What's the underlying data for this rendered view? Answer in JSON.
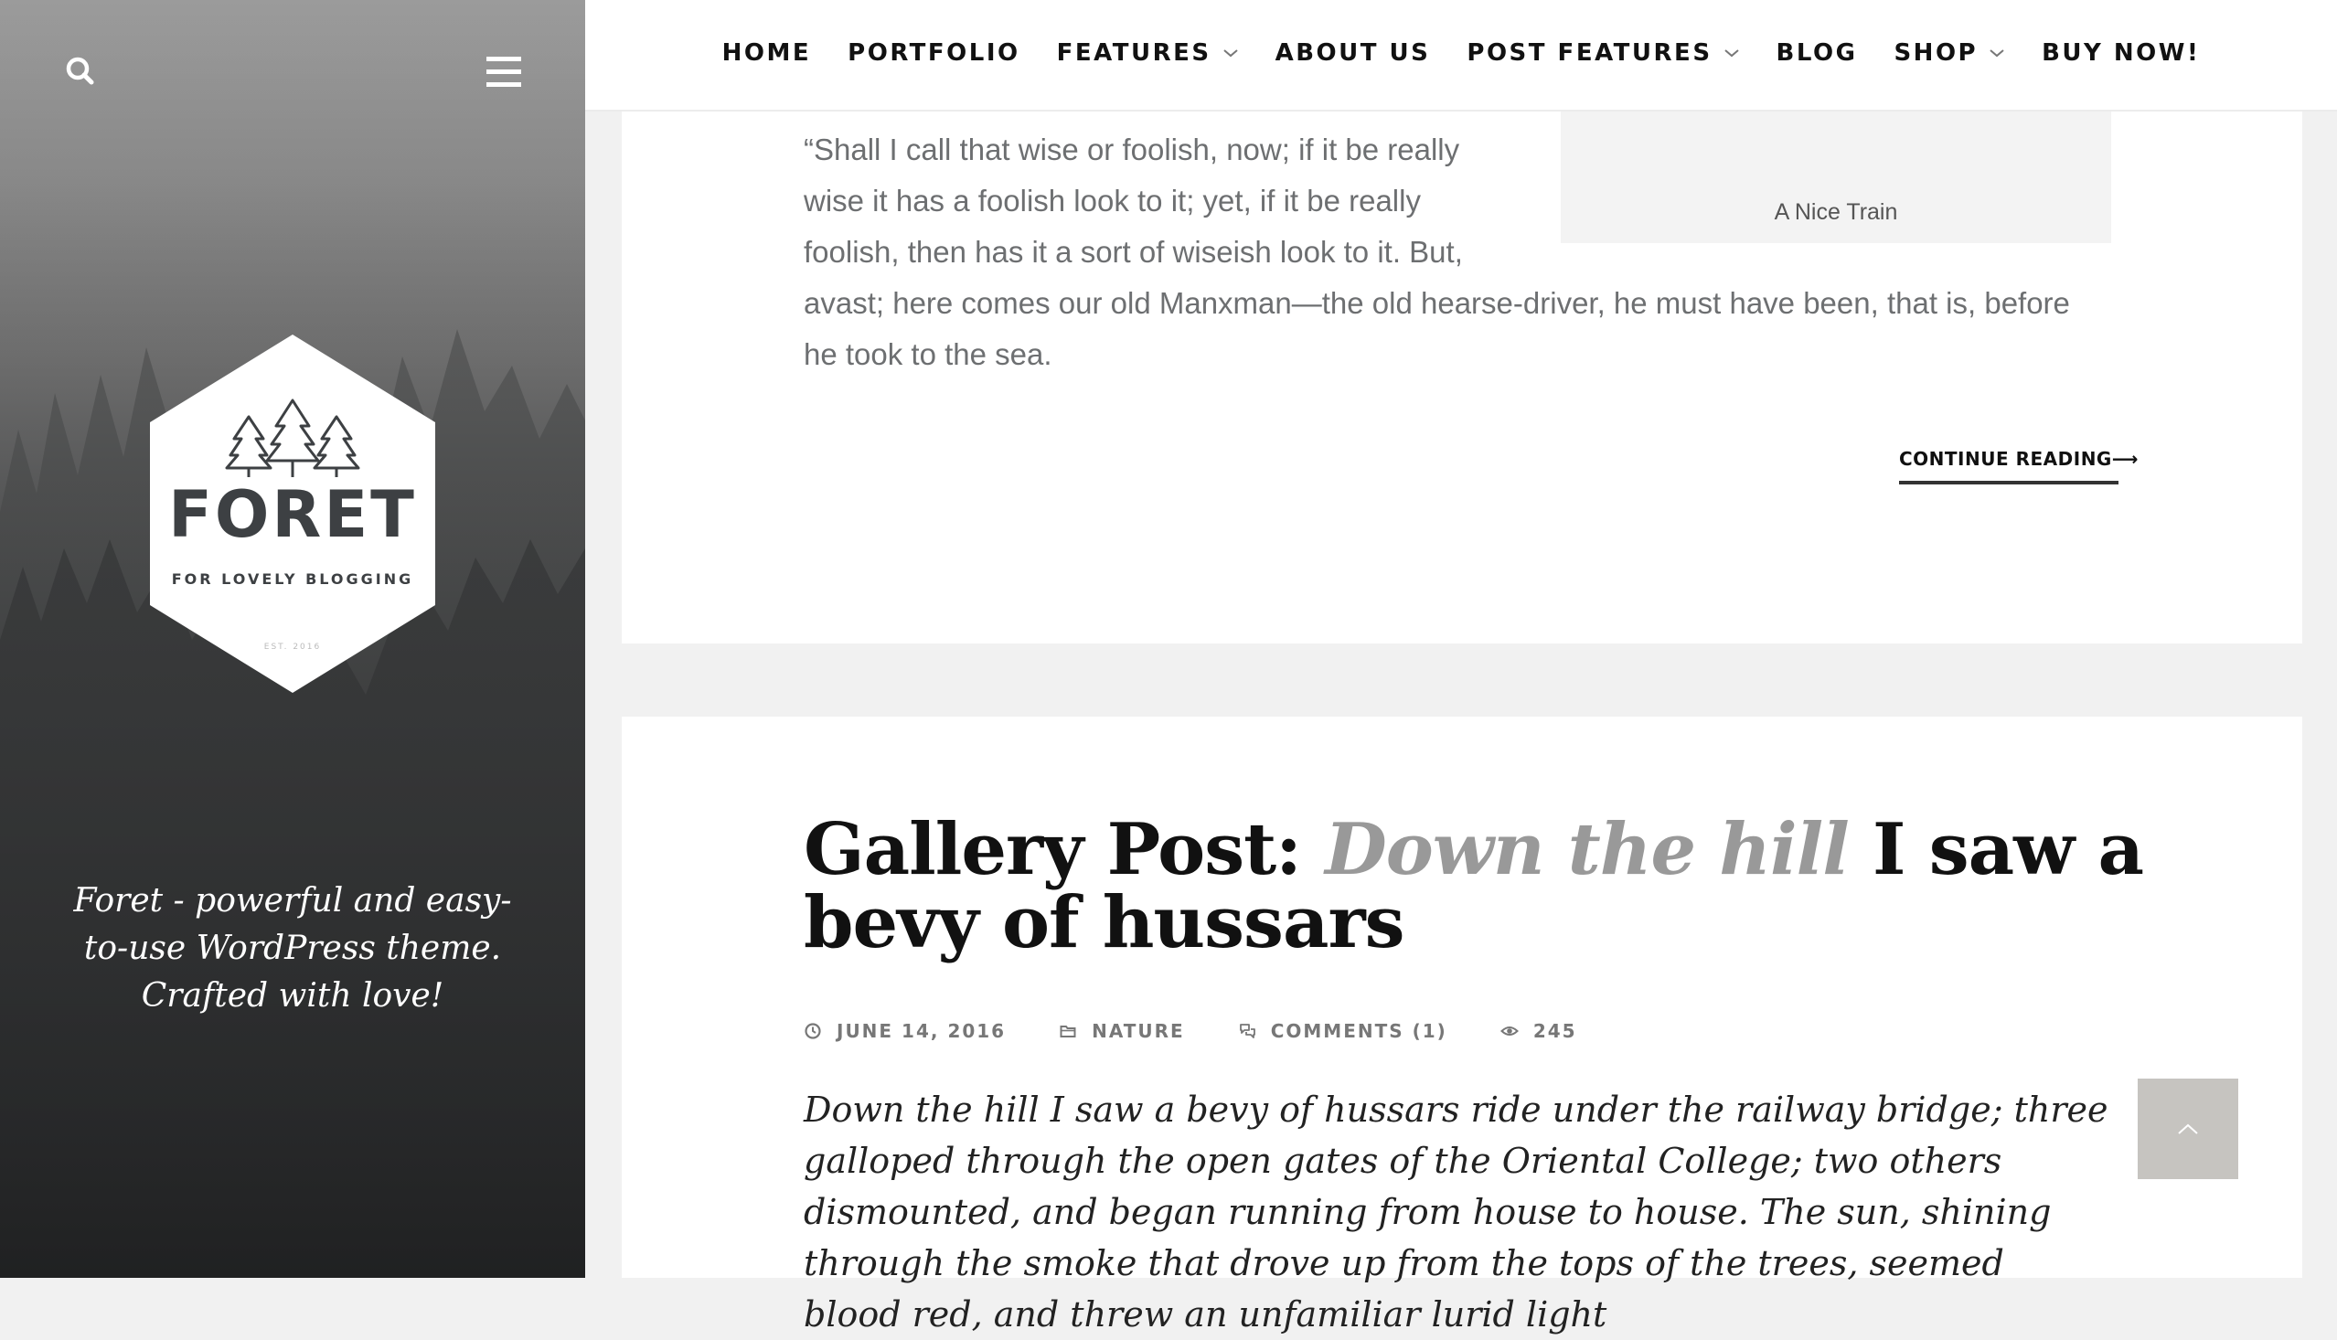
{
  "sidebar": {
    "search_icon": "search-icon",
    "menu_icon": "hamburger-icon",
    "logo": {
      "title": "FORET",
      "subtitle": "FOR LOVELY BLOGGING",
      "est": "EST. 2016"
    },
    "tagline": "Foret - powerful and easy-to-use WordPress theme. Crafted with love!"
  },
  "nav": {
    "items": [
      {
        "label": "HOME",
        "has_dropdown": false
      },
      {
        "label": "PORTFOLIO",
        "has_dropdown": false
      },
      {
        "label": "FEATURES",
        "has_dropdown": true
      },
      {
        "label": "ABOUT US",
        "has_dropdown": false
      },
      {
        "label": "POST FEATURES",
        "has_dropdown": true
      },
      {
        "label": "BLOG",
        "has_dropdown": false
      },
      {
        "label": "SHOP",
        "has_dropdown": true
      },
      {
        "label": "BUY NOW!",
        "has_dropdown": false
      }
    ]
  },
  "post1": {
    "excerpt": "“Shall I call that wise or foolish, now; if it be really wise it has a foolish look to it; yet, if it be really foolish, then has it a sort of wiseish look to it. But, avast; here comes our old Manxman—the old hearse-driver, he must have been, that is, before he took to the sea.",
    "image_caption": "A Nice Train",
    "continue_label": "CONTINUE READING",
    "continue_arrow": "⟶"
  },
  "post2": {
    "title_prefix": "Gallery Post: ",
    "title_accent": "Down the hill",
    "title_suffix": " I saw a bevy of hussars",
    "meta": {
      "date": "JUNE 14, 2016",
      "category": "NATURE",
      "comments": "COMMENTS (1)",
      "views": "245"
    },
    "body": "Down the hill I saw a bevy of hussars ride under the railway bridge; three galloped through the open gates of the Oriental College; two others dismounted, and began running from house to house. The sun, shining through the smoke that drove up from the tops of the trees, seemed blood red, and threw an unfamiliar lurid light"
  },
  "back_to_top_icon": "chevron-up-icon",
  "colors": {
    "accent_gray": "#999999",
    "text_dark": "#111111",
    "back_to_top_bg": "#c6c4c0"
  }
}
